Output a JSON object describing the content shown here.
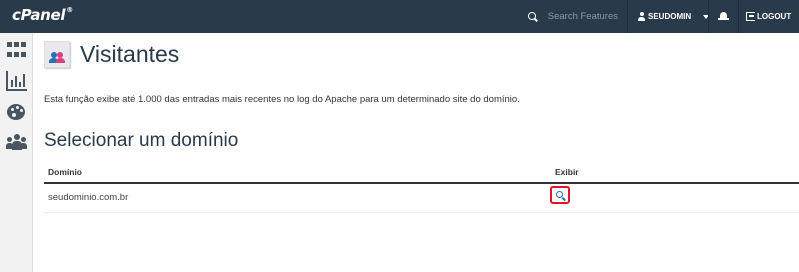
{
  "topbar": {
    "logo": "cPanel",
    "search_placeholder": "Search Features",
    "username": "SEUDOMIN",
    "logout_label": "LOGOUT"
  },
  "page": {
    "title": "Visitantes",
    "description": "Esta função exibe até 1.000 das entradas mais recentes no log do Apache para um determinado site do domínio.",
    "section_title": "Selecionar um domínio"
  },
  "table": {
    "columns": [
      "Domínio",
      "Exibir"
    ],
    "rows": [
      {
        "domain": "seudominio.com.br"
      }
    ]
  },
  "colors": {
    "topbar_bg": "#293a4a",
    "highlight_border": "#e0132a",
    "link_blue": "#1a6db3"
  }
}
